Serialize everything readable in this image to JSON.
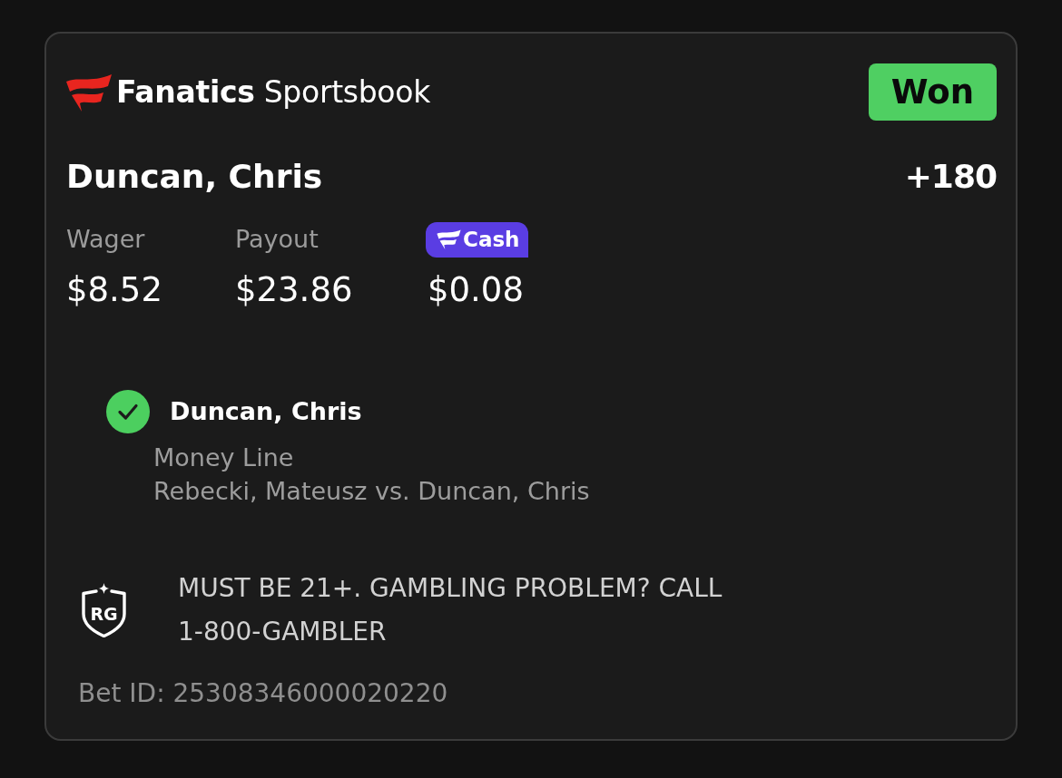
{
  "logo": {
    "wordmark": "**Fanatics** Sportsbook"
  },
  "status": {
    "label": "Won",
    "won": true
  },
  "selection": {
    "name": "Duncan, Chris",
    "odds": "+180"
  },
  "amounts": [
    {
      "kind": "text",
      "label": "Wager",
      "value": "$8.52"
    },
    {
      "kind": "text",
      "label": "Payout",
      "value": "$23.86"
    },
    {
      "kind": "fancash",
      "label": "Cash",
      "value": "$0.08"
    }
  ],
  "leg": {
    "won": true,
    "name": "Duncan, Chris",
    "market": "Money Line",
    "matchup": "Rebecki, Mateusz vs. Duncan, Chris"
  },
  "responsible_gaming": {
    "badge": "RG",
    "notice": "MUST BE 21+. GAMBLING PROBLEM? CALL 1-800-GAMBLER"
  },
  "bet_id": "Bet ID: 25308346000020220"
}
